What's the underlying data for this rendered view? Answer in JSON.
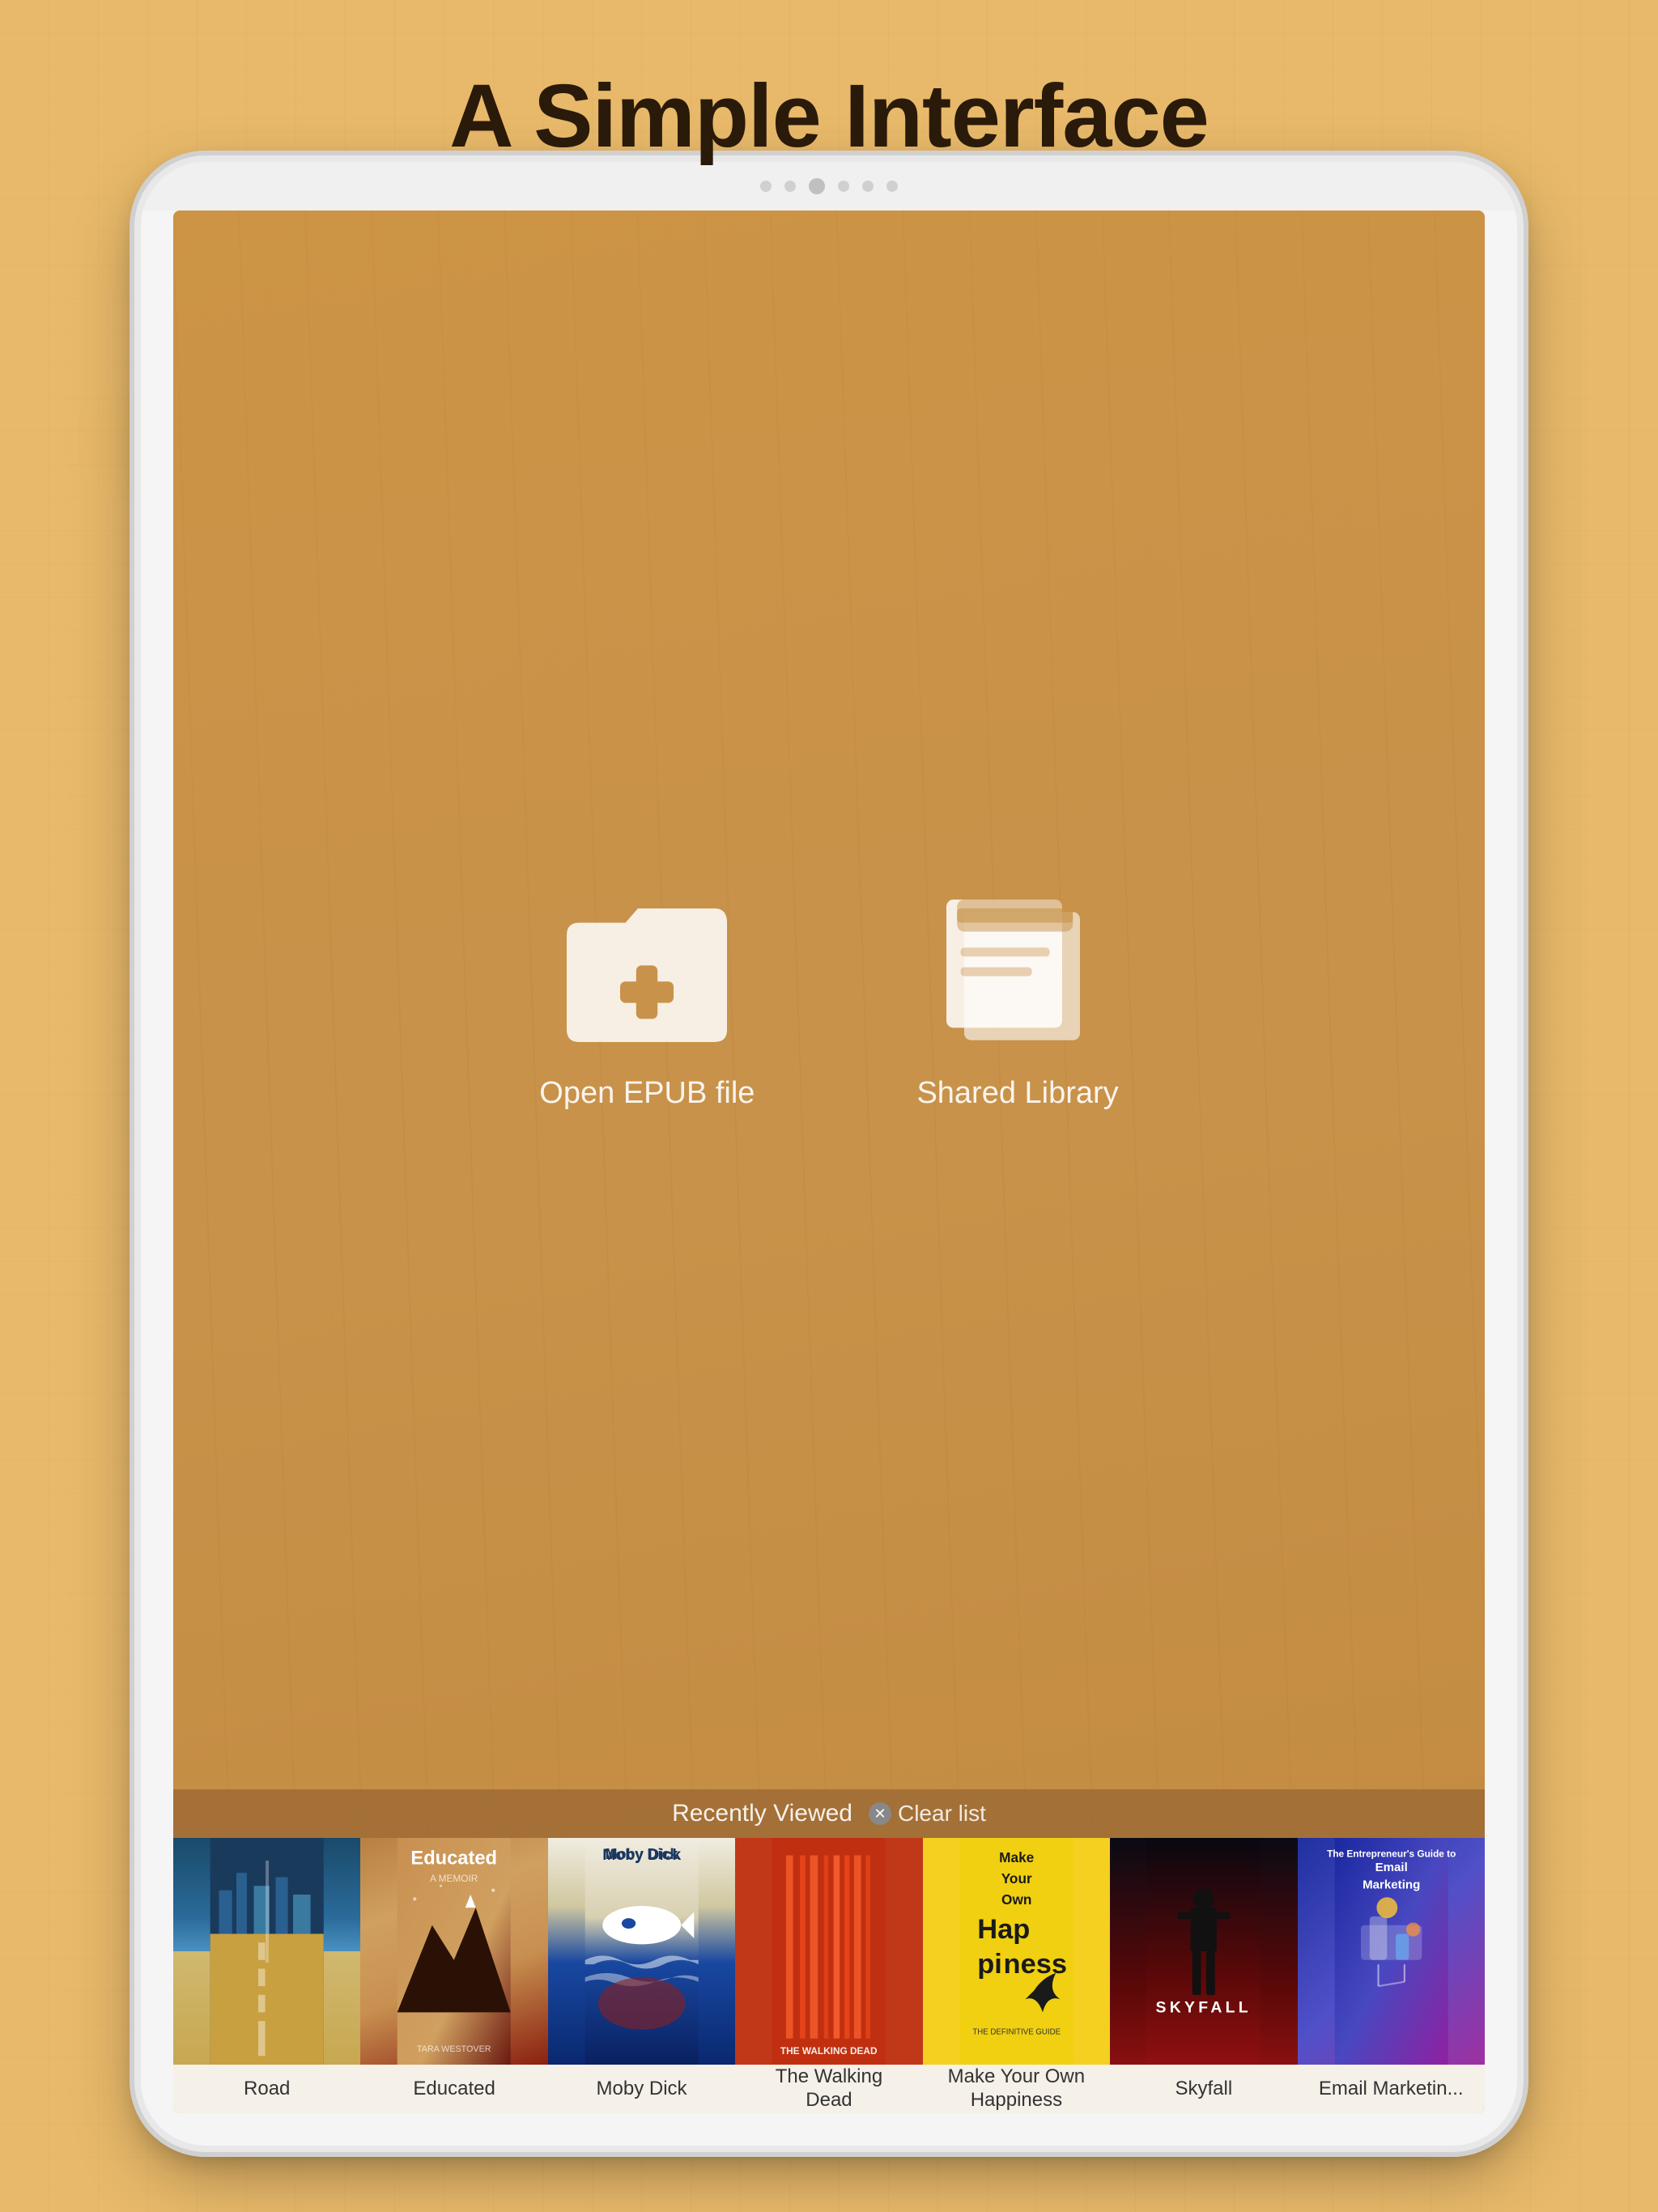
{
  "page": {
    "title": "A Simple Interface",
    "background_color": "#e8b96a"
  },
  "tablet": {
    "screen_bg": "#c8924a"
  },
  "actions": [
    {
      "id": "open-epub",
      "label": "Open EPUB file",
      "icon": "folder-add-icon"
    },
    {
      "id": "shared-library",
      "label": "Shared Library",
      "icon": "books-icon"
    }
  ],
  "recently_viewed": {
    "label": "Recently Viewed",
    "clear_label": "Clear list",
    "books": [
      {
        "id": "road",
        "title": "Road",
        "cover_style": "road"
      },
      {
        "id": "educated",
        "title": "Educated",
        "cover_style": "educated"
      },
      {
        "id": "moby-dick",
        "title": "Moby Dick",
        "cover_style": "moby"
      },
      {
        "id": "walking-dead",
        "title": "The Walking Dead",
        "cover_style": "walking"
      },
      {
        "id": "happiness",
        "title": "Make Your Own Happiness",
        "cover_style": "happiness"
      },
      {
        "id": "skyfall",
        "title": "Skyfall",
        "cover_style": "skyfall"
      },
      {
        "id": "email-marketing",
        "title": "Email Marketing",
        "cover_style": "email"
      }
    ]
  },
  "tablet_dots": [
    "dot1",
    "dot2",
    "camera",
    "dot3",
    "dot4",
    "dot5"
  ]
}
